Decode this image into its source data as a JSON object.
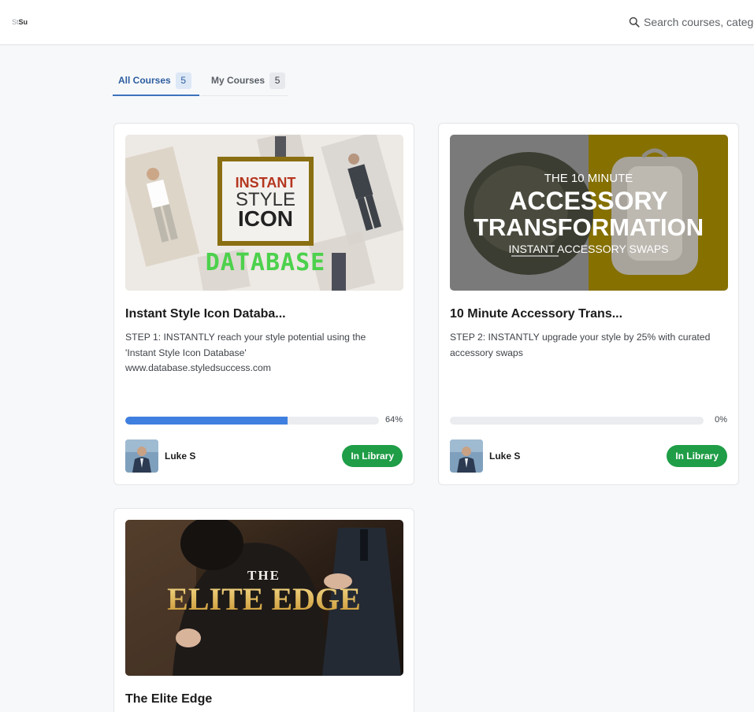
{
  "header": {
    "logo_line1": "St",
    "logo_line2": "Su",
    "search_placeholder": "Search courses, categories"
  },
  "tabs": [
    {
      "label": "All Courses",
      "count": "5",
      "active": true
    },
    {
      "label": "My Courses",
      "count": "5",
      "active": false
    }
  ],
  "colors": {
    "accent": "#3c73bd",
    "progress": "#3f7fe0",
    "badge_green": "#1f9d47",
    "thumb2_olive": "#857000"
  },
  "courses": [
    {
      "title": "Instant Style Icon Databa...",
      "description": "STEP 1: INSTANTLY reach your style potential using the 'Instant Style Icon Database' www.database.styledsuccess.com",
      "progress": 0.64,
      "progress_label": "64%",
      "author": "Luke S",
      "badge": "In Library",
      "thumb": {
        "line1": "INSTANT",
        "line2": "STYLE",
        "line3": "ICON",
        "line4": "DATABASE"
      }
    },
    {
      "title": "10 Minute Accessory Trans...",
      "description": "STEP 2: INSTANTLY upgrade your style by 25% with curated accessory swaps",
      "progress": 0,
      "progress_label": "0%",
      "author": "Luke S",
      "badge": "In Library",
      "thumb": {
        "line1": "THE 10 MINUTE",
        "line2": "ACCESSORY",
        "line3": "TRANSFORMATION",
        "line4": "INSTANT ACCESSORY SWAPS"
      }
    },
    {
      "title": "The Elite Edge",
      "thumb": {
        "line1": "THE",
        "line2": "ELITE EDGE"
      }
    }
  ]
}
